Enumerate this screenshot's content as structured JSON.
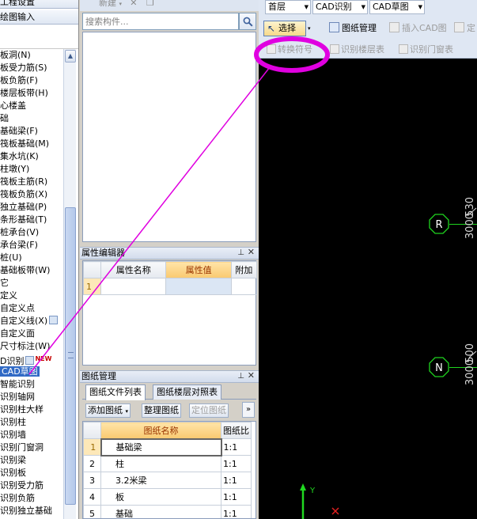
{
  "left_pane": {
    "header_top": "工程设置",
    "header_second": "绘图输入",
    "items": [
      {
        "label": "板洞(N)",
        "selected": false
      },
      {
        "label": "板受力筋(S)",
        "selected": false
      },
      {
        "label": "板负筋(F)",
        "selected": false
      },
      {
        "label": "楼层板带(H)",
        "selected": false
      },
      {
        "label": "心楼盖",
        "selected": false
      },
      {
        "label": "础",
        "selected": false
      },
      {
        "label": "基础梁(F)",
        "selected": false
      },
      {
        "label": "筏板基础(M)",
        "selected": false
      },
      {
        "label": "集水坑(K)",
        "selected": false
      },
      {
        "label": "柱墩(Y)",
        "selected": false
      },
      {
        "label": "筏板主筋(R)",
        "selected": false
      },
      {
        "label": "筏板负筋(X)",
        "selected": false
      },
      {
        "label": "独立基础(P)",
        "selected": false
      },
      {
        "label": "条形基础(T)",
        "selected": false
      },
      {
        "label": "桩承台(V)",
        "selected": false
      },
      {
        "label": "承台梁(F)",
        "selected": false
      },
      {
        "label": "桩(U)",
        "selected": false
      },
      {
        "label": "基础板带(W)",
        "selected": false
      },
      {
        "label": "它",
        "selected": false
      },
      {
        "label": "定义",
        "selected": false
      },
      {
        "label": "自定义点",
        "selected": false
      },
      {
        "label": "自定义线(X)",
        "selected": false
      },
      {
        "label": "自定义面",
        "selected": false
      },
      {
        "label": "尺寸标注(W)",
        "selected": false
      },
      {
        "label": "D识别",
        "selected": false
      },
      {
        "label": "CAD草图",
        "selected": true
      },
      {
        "label": "智能识别",
        "selected": false
      },
      {
        "label": "识别轴网",
        "selected": false
      },
      {
        "label": "识别柱大样",
        "selected": false
      },
      {
        "label": "识别柱",
        "selected": false
      },
      {
        "label": "识别墙",
        "selected": false
      },
      {
        "label": "识别门窗洞",
        "selected": false
      },
      {
        "label": "识别梁",
        "selected": false
      },
      {
        "label": "识别板",
        "selected": false
      },
      {
        "label": "识别受力筋",
        "selected": false
      },
      {
        "label": "识别负筋",
        "selected": false
      },
      {
        "label": "识别独立基础",
        "selected": false
      }
    ],
    "new_badge": "NEW"
  },
  "component_panel": {
    "toolbar_new": "新建",
    "search_placeholder": "搜索构件..."
  },
  "property_editor": {
    "title": "属性编辑器",
    "columns": [
      "属性名称",
      "属性值",
      "附加"
    ],
    "rows": [
      {
        "num": "1",
        "name": "",
        "value": "",
        "extra": ""
      }
    ]
  },
  "drawing_management": {
    "title": "图纸管理",
    "tabs": [
      "图纸文件列表",
      "图纸楼层对照表"
    ],
    "buttons": {
      "add": "添加图纸",
      "organize": "整理图纸",
      "locate": "定位图纸",
      "more": "»"
    },
    "columns": [
      "图纸名称",
      "图纸比"
    ],
    "rows": [
      {
        "num": "1",
        "name": "基础梁",
        "ratio": "1:1"
      },
      {
        "num": "2",
        "name": "柱",
        "ratio": "1:1"
      },
      {
        "num": "3",
        "name": "3.2米梁",
        "ratio": "1:1"
      },
      {
        "num": "4",
        "name": "板",
        "ratio": "1:1"
      },
      {
        "num": "5",
        "name": "基础",
        "ratio": "1:1"
      }
    ]
  },
  "top_toolbar": {
    "floor_select": "首层",
    "mode_select": "CAD识别",
    "layer_select": "CAD草图",
    "select_btn": "选择",
    "drawing_mgmt_btn": "图纸管理",
    "insert_cad_btn": "插入CAD图",
    "locate_btn": "定",
    "convert_symbol_btn": "转换符号",
    "identify_floor_table_btn": "识别楼层表",
    "identify_door_window_table_btn": "识别门窗表"
  },
  "canvas": {
    "axis_labels": [
      "R",
      "N"
    ],
    "dimensions": [
      "3000",
      "530",
      "3000",
      "500"
    ],
    "ucs_y_label": "Y"
  },
  "colors": {
    "annotation_magenta": "#e000e0",
    "canvas_bg": "#000000",
    "axis_green": "#14c814",
    "selected_blue": "#316ac5"
  }
}
